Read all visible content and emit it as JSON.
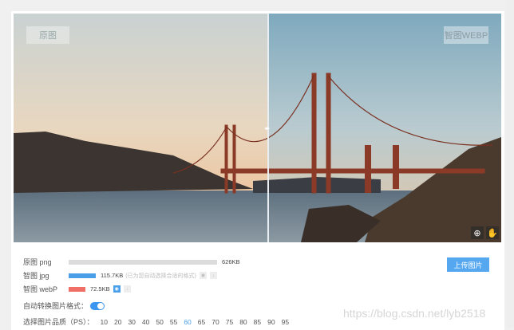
{
  "viewer": {
    "label_original": "原图",
    "label_smart": "智图WEBP"
  },
  "rows": [
    {
      "label": "原图 png",
      "size": "626KB",
      "fill": 1.0,
      "color": "#dcdcdc"
    },
    {
      "label": "智图 jpg",
      "size": "115.7KB",
      "note": "(已为您自动选择合适的格式)",
      "fill": 0.185,
      "color": "#4a9fe8"
    },
    {
      "label": "智图 webP",
      "size": "72.5KB",
      "fill": 0.116,
      "color": "#f07068"
    }
  ],
  "auto_convert": {
    "label": "自动转换图片格式：",
    "on": true
  },
  "quality": {
    "label": "选择图片品质（PS）：",
    "options": [
      "10",
      "20",
      "30",
      "40",
      "50",
      "55",
      "60",
      "65",
      "70",
      "75",
      "80",
      "85",
      "90",
      "95"
    ],
    "selected": "60"
  },
  "upload_label": "上传图片",
  "watermark": "https://blog.csdn.net/lyb2518"
}
